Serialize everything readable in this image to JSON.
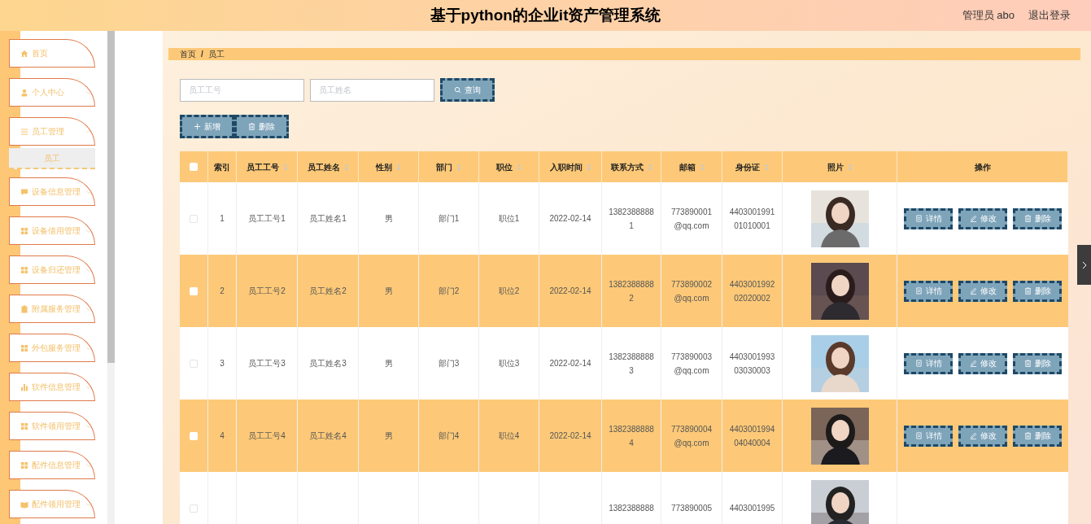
{
  "header": {
    "title": "基于python的企业it资产管理系统",
    "user": "管理员 abo",
    "logout": "退出登录"
  },
  "sidebar": {
    "items": [
      {
        "label": "首页"
      },
      {
        "label": "个人中心",
        "expanded": false
      },
      {
        "label": "员工管理",
        "expanded": true,
        "children": [
          {
            "label": "员工"
          }
        ]
      },
      {
        "label": "设备信息管理",
        "expanded": false
      },
      {
        "label": "设备借用管理",
        "expanded": false
      },
      {
        "label": "设备归还管理",
        "expanded": false
      },
      {
        "label": "附属服务管理",
        "expanded": false
      },
      {
        "label": "外包服务管理",
        "expanded": false
      },
      {
        "label": "软件信息管理",
        "expanded": false
      },
      {
        "label": "软件领用管理",
        "expanded": false
      },
      {
        "label": "配件信息管理",
        "expanded": false
      },
      {
        "label": "配件领用管理",
        "expanded": false
      }
    ]
  },
  "breadcrumb": [
    "首页",
    "/",
    "员工"
  ],
  "search": {
    "fields": [
      {
        "placeholder": "员工工号"
      },
      {
        "placeholder": "员工姓名"
      }
    ],
    "button": "查询"
  },
  "toolbar": [
    {
      "kind": "add",
      "label": "新增"
    },
    {
      "kind": "delete",
      "label": "删除"
    }
  ],
  "table": {
    "all_checked": false,
    "columns": [
      {
        "label": "索引",
        "sortable": false
      },
      {
        "label": "员工工号",
        "sortable": true
      },
      {
        "label": "员工姓名",
        "sortable": true
      },
      {
        "label": "性别",
        "sortable": true
      },
      {
        "label": "部门",
        "sortable": true
      },
      {
        "label": "职位",
        "sortable": true
      },
      {
        "label": "入职时间",
        "sortable": true
      },
      {
        "label": "联系方式",
        "sortable": true
      },
      {
        "label": "邮箱",
        "sortable": true
      },
      {
        "label": "身份证",
        "sortable": true
      },
      {
        "label": "照片",
        "sortable": true
      },
      {
        "label": "操作",
        "sortable": false
      }
    ],
    "rows": [
      {
        "checked": false,
        "cells": [
          "1",
          "员工工号1",
          "员工姓名1",
          "男",
          "部门1",
          "职位1",
          "2022-02-14",
          [
            "1382388888",
            "1"
          ],
          [
            "773890001",
            "@qq.com"
          ],
          [
            "4403001991",
            "01010001"
          ]
        ],
        "photo": true,
        "actions": [
          {
            "kind": "detail",
            "label": "详情"
          },
          {
            "kind": "edit",
            "label": "修改"
          },
          {
            "kind": "delete",
            "label": "删除"
          }
        ]
      },
      {
        "checked": false,
        "cells": [
          "2",
          "员工工号2",
          "员工姓名2",
          "男",
          "部门2",
          "职位2",
          "2022-02-14",
          [
            "1382388888",
            "2"
          ],
          [
            "773890002",
            "@qq.com"
          ],
          [
            "4403001992",
            "02020002"
          ]
        ],
        "photo": true,
        "actions": [
          {
            "kind": "detail",
            "label": "详情"
          },
          {
            "kind": "edit",
            "label": "修改"
          },
          {
            "kind": "delete",
            "label": "删除"
          }
        ]
      },
      {
        "checked": false,
        "cells": [
          "3",
          "员工工号3",
          "员工姓名3",
          "男",
          "部门3",
          "职位3",
          "2022-02-14",
          [
            "1382388888",
            "3"
          ],
          [
            "773890003",
            "@qq.com"
          ],
          [
            "4403001993",
            "03030003"
          ]
        ],
        "photo": true,
        "actions": [
          {
            "kind": "detail",
            "label": "详情"
          },
          {
            "kind": "edit",
            "label": "修改"
          },
          {
            "kind": "delete",
            "label": "删除"
          }
        ]
      },
      {
        "checked": false,
        "cells": [
          "4",
          "员工工号4",
          "员工姓名4",
          "男",
          "部门4",
          "职位4",
          "2022-02-14",
          [
            "1382388888",
            "4"
          ],
          [
            "773890004",
            "@qq.com"
          ],
          [
            "4403001994",
            "04040004"
          ]
        ],
        "photo": true,
        "actions": [
          {
            "kind": "detail",
            "label": "详情"
          },
          {
            "kind": "edit",
            "label": "修改"
          },
          {
            "kind": "delete",
            "label": "删除"
          }
        ]
      },
      {
        "checked": false,
        "cells": [
          "",
          "",
          "",
          "",
          "",
          "",
          "",
          [
            "1382388888"
          ],
          [
            "773890005"
          ],
          [
            "4403001995"
          ]
        ],
        "photo": true
      }
    ]
  }
}
